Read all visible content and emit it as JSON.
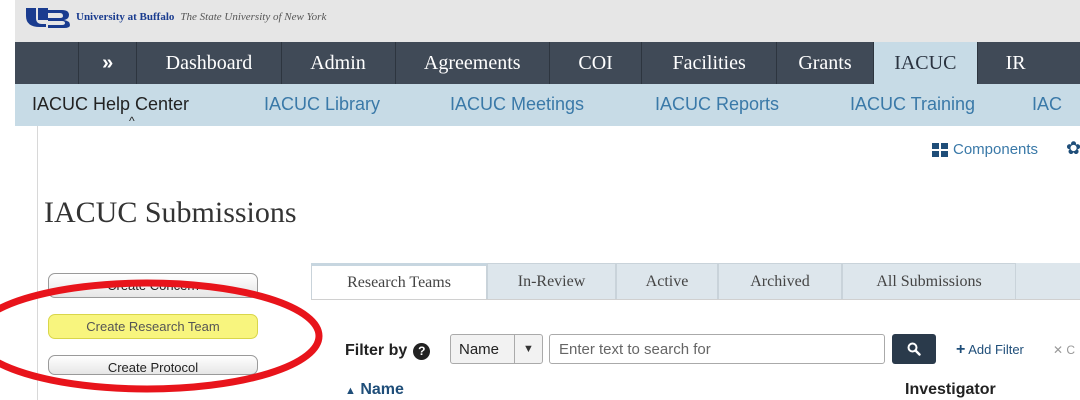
{
  "header": {
    "university_name": "University at Buffalo",
    "university_subtitle": "The State University of New York"
  },
  "main_nav": {
    "expand_symbol": "»",
    "items": [
      {
        "label": "Dashboard"
      },
      {
        "label": "Admin"
      },
      {
        "label": "Agreements"
      },
      {
        "label": "COI"
      },
      {
        "label": "Facilities"
      },
      {
        "label": "Grants"
      },
      {
        "label": "IACUC",
        "active": true
      },
      {
        "label": "IR"
      }
    ]
  },
  "sub_nav": {
    "items": [
      {
        "label": "IACUC Help Center",
        "current": true
      },
      {
        "label": "IACUC Library"
      },
      {
        "label": "IACUC Meetings"
      },
      {
        "label": "IACUC Reports"
      },
      {
        "label": "IACUC Training"
      },
      {
        "label": "IAC"
      }
    ],
    "caret": "^"
  },
  "toolbar": {
    "components_label": "Components"
  },
  "page": {
    "title": "IACUC Submissions"
  },
  "actions": {
    "create_concern": "Create Concern",
    "create_research_team": "Create Research Team",
    "create_protocol": "Create Protocol"
  },
  "tabs": [
    {
      "label": "Research Teams",
      "active": true
    },
    {
      "label": "In-Review"
    },
    {
      "label": "Active"
    },
    {
      "label": "Archived"
    },
    {
      "label": "All Submissions"
    }
  ],
  "filter": {
    "label": "Filter by",
    "field_value": "Name",
    "search_placeholder": "Enter text to search for",
    "add_filter_label": "Add Filter",
    "clear_label": "C"
  },
  "table": {
    "columns": [
      {
        "label": "Name",
        "sorted": "asc"
      },
      {
        "label": "Investigator"
      }
    ]
  },
  "colors": {
    "nav_bg": "#404a57",
    "subnav_bg": "#c7dbe6",
    "link_blue": "#3a79a8",
    "highlight_yellow": "#f8f57e",
    "annotation_red": "#e8141b"
  }
}
